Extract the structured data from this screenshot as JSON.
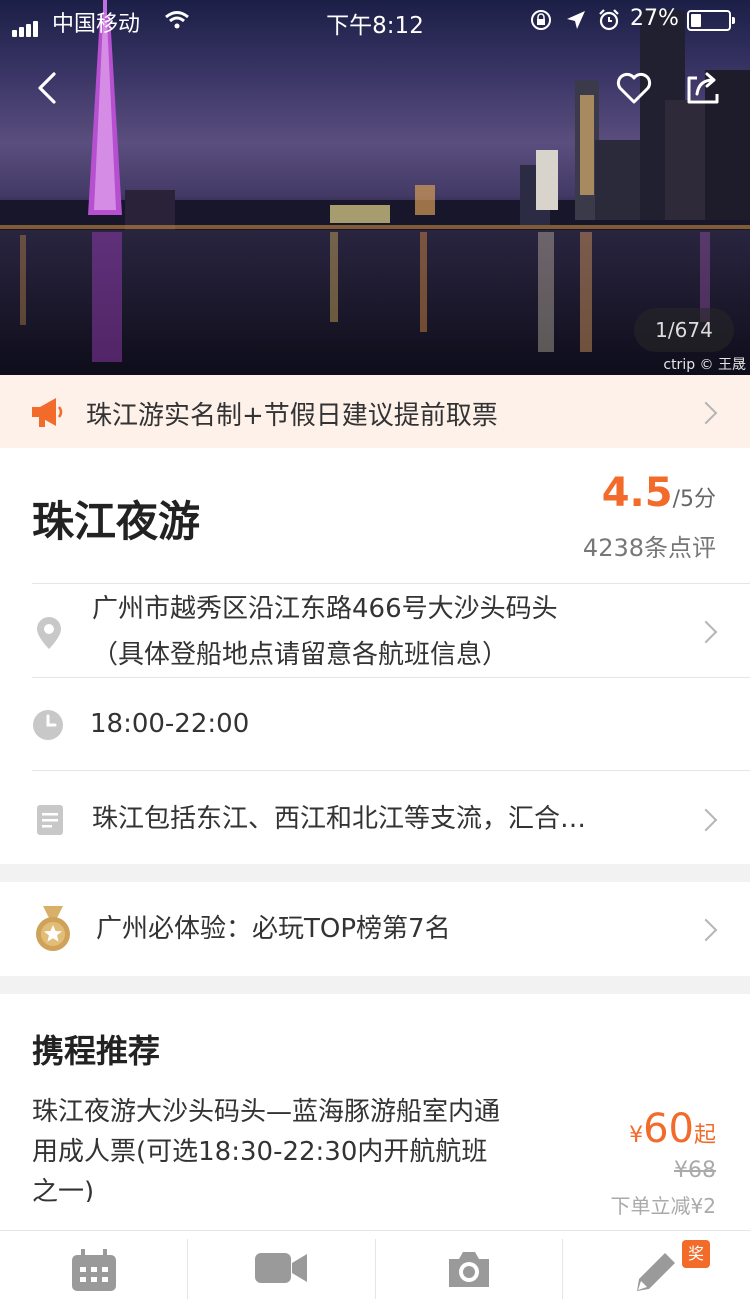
{
  "status_bar": {
    "carrier": "中国移动",
    "time": "下午8:12",
    "battery": "27%"
  },
  "hero": {
    "photo_counter": "1/674",
    "credit": "ctrip © 王晟"
  },
  "notice": {
    "text": "珠江游实名制+节假日建议提前取票"
  },
  "attraction": {
    "name": "珠江夜游",
    "rating": "4.5",
    "rating_unit": "/5分",
    "review_count": "4238条点评",
    "address_line1": "广州市越秀区沿江东路466号大沙头码头",
    "address_line2": "（具体登船地点请留意各航班信息）",
    "hours": "18:00-22:00",
    "description": "珠江包括东江、西江和北江等支流，汇合…"
  },
  "ranking": {
    "text": "广州必体验：必玩TOP榜第7名"
  },
  "recommend": {
    "title": "携程推荐",
    "product_name": "珠江夜游大沙头码头—蓝海豚游船室内通用成人票(可选18:30-22:30内开航航班之一)",
    "currency": "¥",
    "price": "60",
    "price_suffix": "起",
    "original_price": "¥68",
    "promo": "下单立减¥2"
  },
  "tabbar": {
    "badge": "奖"
  },
  "colors": {
    "accent": "#f26b2a",
    "notice_bg": "#fdf1ea"
  }
}
